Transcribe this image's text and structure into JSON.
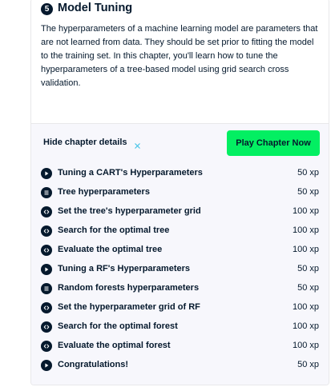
{
  "chapter": {
    "number": "5",
    "title": "Model Tuning",
    "description": "The hyperparameters of a machine learning model are parameters that are not learned from data. They should be set prior to fitting the model to the training set. In this chapter, you'll learn how to tune the hyperparameters of a tree-based model using grid search cross validation."
  },
  "actions": {
    "hide_details_label": "Hide chapter details",
    "play_label": "Play Chapter Now"
  },
  "colors": {
    "accent": "#03ef62",
    "ink": "#05192d",
    "muted_icon": "#3ac1e6"
  },
  "exercises": [
    {
      "type": "video",
      "icon": "play-icon",
      "title": "Tuning a CART's Hyperparameters",
      "xp": "50 xp"
    },
    {
      "type": "multiple-choice",
      "icon": "list-icon",
      "title": "Tree hyperparameters",
      "xp": "50 xp"
    },
    {
      "type": "code",
      "icon": "code-icon",
      "title": "Set the tree's hyperparameter grid",
      "xp": "100 xp"
    },
    {
      "type": "code",
      "icon": "code-icon",
      "title": "Search for the optimal tree",
      "xp": "100 xp"
    },
    {
      "type": "code",
      "icon": "code-icon",
      "title": "Evaluate the optimal tree",
      "xp": "100 xp"
    },
    {
      "type": "video",
      "icon": "play-icon",
      "title": "Tuning a RF's Hyperparameters",
      "xp": "50 xp"
    },
    {
      "type": "multiple-choice",
      "icon": "list-icon",
      "title": "Random forests hyperparameters",
      "xp": "50 xp"
    },
    {
      "type": "code",
      "icon": "code-icon",
      "title": "Set the hyperparameter grid of RF",
      "xp": "100 xp"
    },
    {
      "type": "code",
      "icon": "code-icon",
      "title": "Search for the optimal forest",
      "xp": "100 xp"
    },
    {
      "type": "code",
      "icon": "code-icon",
      "title": "Evaluate the optimal forest",
      "xp": "100 xp"
    },
    {
      "type": "video",
      "icon": "play-icon",
      "title": "Congratulations!",
      "xp": "50 xp"
    }
  ]
}
